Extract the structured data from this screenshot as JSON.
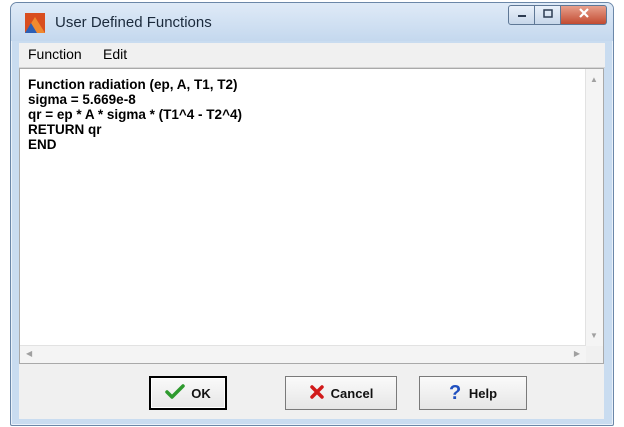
{
  "window": {
    "title": "User Defined Functions",
    "icon": "app-logo-icon",
    "controls": [
      "minimize-icon",
      "maximize-icon",
      "close-icon"
    ]
  },
  "menu": {
    "items": [
      {
        "label": "Function"
      },
      {
        "label": "Edit"
      }
    ]
  },
  "editor": {
    "code": "Function radiation (ep, A, T1, T2)\nsigma = 5.669e-8\nqr = ep * A * sigma * (T1^4 - T2^4)\nRETURN qr\nEND"
  },
  "buttons": {
    "ok": {
      "label": "OK",
      "icon": "checkmark-icon",
      "color": "#2e9a2e"
    },
    "cancel": {
      "label": "Cancel",
      "icon": "x-icon",
      "color": "#d11a1a"
    },
    "help": {
      "label": "Help",
      "icon": "question-icon",
      "color": "#1f4fbf"
    }
  }
}
